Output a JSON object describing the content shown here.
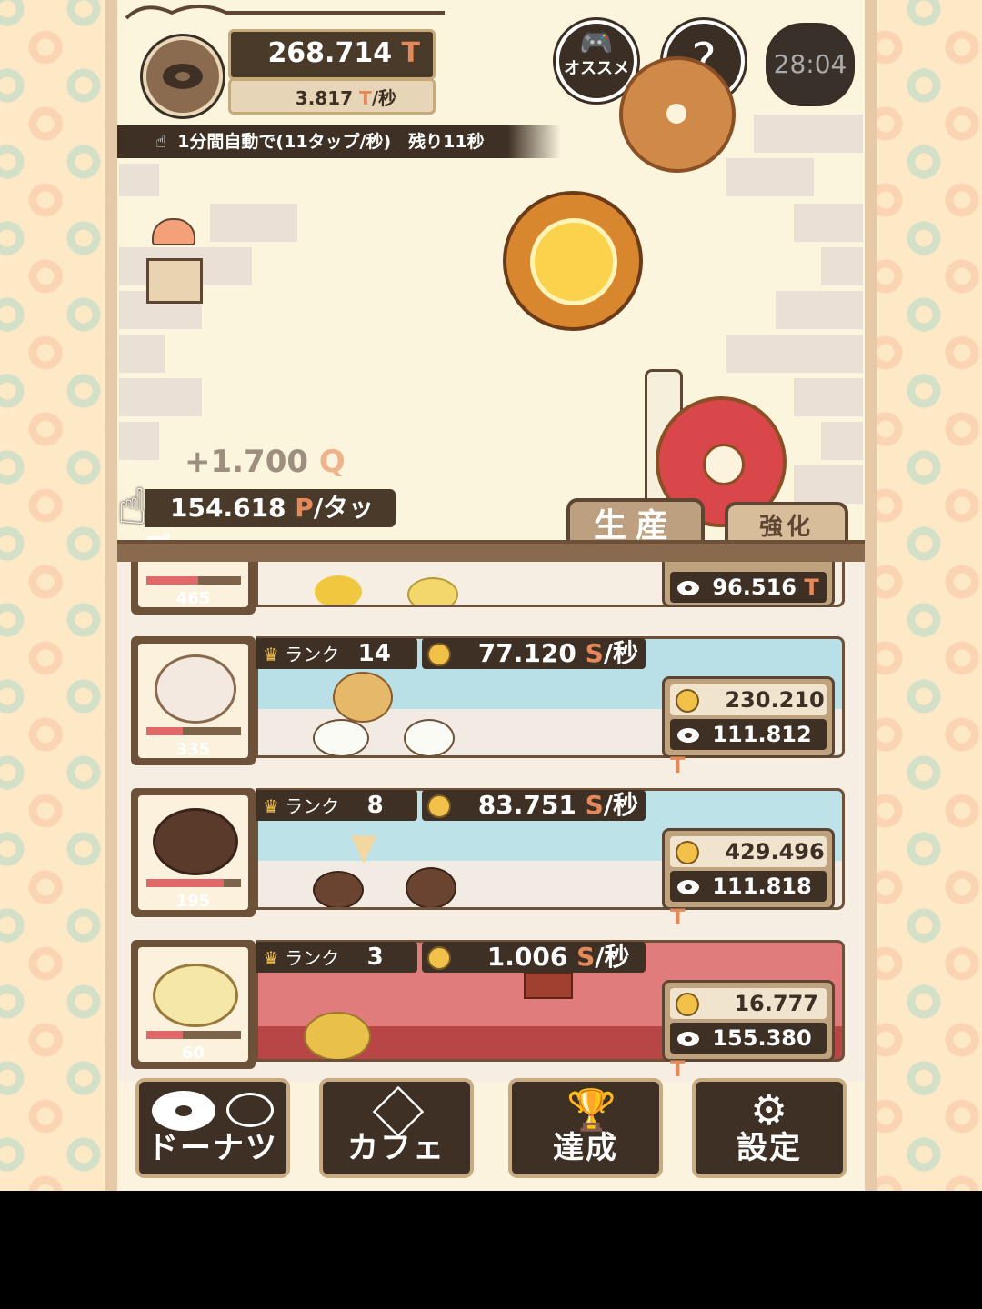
{
  "hud": {
    "total_value": "268.714",
    "total_unit": "T",
    "rate_value": "3.817",
    "rate_unit": "T",
    "rate_suffix": "/秒",
    "recommend_label": "オススメ",
    "help_label": "?",
    "timer": "28:04"
  },
  "auto_tap": {
    "text": "1分間自動で(11タップ/秒)　残り11秒"
  },
  "tap_info": {
    "popup_value": "+1.700",
    "popup_unit": "Q",
    "per_tap_value": "154.618",
    "per_tap_unit": "P",
    "per_tap_suffix": "/タップ"
  },
  "tabs": {
    "production": "生産",
    "upgrade": "強化"
  },
  "rows": [
    {
      "count": "465",
      "progress": 0.55,
      "cost_value": "96.516",
      "cost_unit": "T"
    },
    {
      "rank_label": "ランク",
      "rank": "14",
      "rate_value": "77.120",
      "rate_unit": "S",
      "rate_suffix": "/秒",
      "count": "335",
      "progress": 0.38,
      "upgrade_cost": "230.210",
      "upgrade_unit": "R",
      "donut_cost": "111.812",
      "donut_unit": "T",
      "belt_color": "#b9e0e6"
    },
    {
      "rank_label": "ランク",
      "rank": "8",
      "rate_value": "83.751",
      "rate_unit": "S",
      "rate_suffix": "/秒",
      "count": "195",
      "progress": 0.82,
      "upgrade_cost": "429.496",
      "upgrade_unit": "R",
      "donut_cost": "111.818",
      "donut_unit": "T",
      "belt_color": "#bde2e8"
    },
    {
      "rank_label": "ランク",
      "rank": "3",
      "rate_value": "1.006",
      "rate_unit": "S",
      "rate_suffix": "/秒",
      "count": "60",
      "progress": 0.38,
      "upgrade_cost": "16.777",
      "upgrade_unit": "R",
      "donut_cost": "155.380",
      "donut_unit": "T",
      "belt_color": "#e07c7c"
    }
  ],
  "nav": {
    "donuts": "ドーナツ",
    "cafe": "カフェ",
    "achievements": "達成",
    "settings": "設定"
  }
}
